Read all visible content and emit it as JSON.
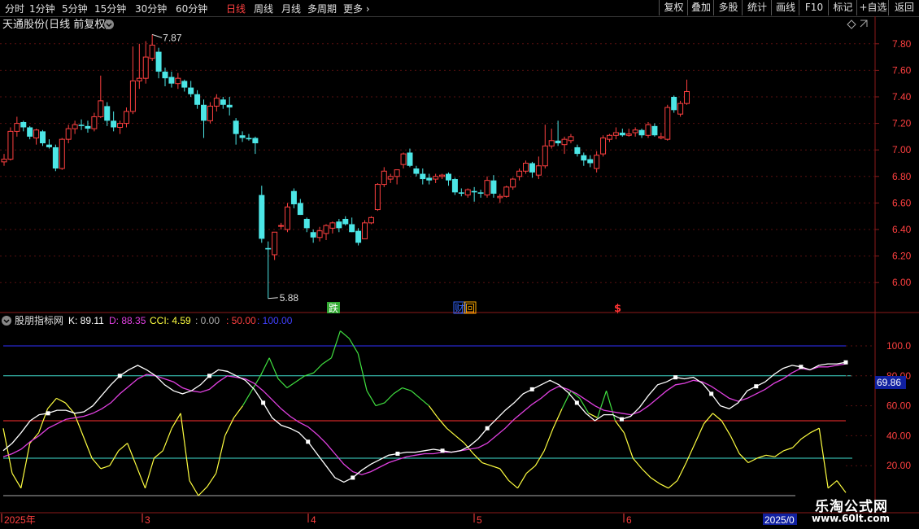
{
  "toolbar": {
    "timeframes": [
      {
        "label": "分时",
        "active": false
      },
      {
        "label": "1分钟",
        "active": false
      },
      {
        "label": "5分钟",
        "active": false
      },
      {
        "label": "15分钟",
        "active": false
      },
      {
        "label": "30分钟",
        "active": false
      },
      {
        "label": "60分钟",
        "active": false
      },
      {
        "label": "日线",
        "active": true
      },
      {
        "label": "周线",
        "active": false
      },
      {
        "label": "月线",
        "active": false
      },
      {
        "label": "多周期",
        "active": false
      },
      {
        "label": "更多",
        "active": false
      }
    ],
    "buttons": [
      "复权",
      "叠加",
      "多股",
      "统计",
      "画线",
      "F10",
      "标记",
      "+自选",
      "返回"
    ]
  },
  "stock": {
    "title": "天通股份(日线 前复权)"
  },
  "price_chart": {
    "y_ticks": [
      "7.80",
      "7.60",
      "7.40",
      "7.20",
      "7.00",
      "6.80",
      "6.60",
      "6.40",
      "6.20",
      "6.00"
    ],
    "high_label": "7.87",
    "low_label": "5.88",
    "markers": [
      {
        "text": "跌",
        "color": "#33aa33"
      },
      {
        "text": "财",
        "color": "#3366ff"
      },
      {
        "text": "回",
        "color": "#ffaa00"
      },
      {
        "text": "$",
        "color": "#ff3333"
      }
    ]
  },
  "indicator": {
    "name": "股朋指标网",
    "k_label": "K: 89.11",
    "d_label": "D: 88.35",
    "cci_label": "CCI: 4.59",
    "v0": ": 0.00",
    "v50": ": 50.00",
    "v100": ": 100.00",
    "y_ticks": [
      "100.0",
      "80.00",
      "60.00",
      "40.00",
      "20.00"
    ],
    "current": "69.86"
  },
  "date_axis": {
    "labels": [
      "2025年",
      "3",
      "4",
      "5",
      "6"
    ],
    "current": "2025/0"
  },
  "watermark": {
    "line1": "乐淘公式网",
    "line2": "www.60lt.com"
  },
  "colors": {
    "up": "#ff4040",
    "down": "#4ce6e6",
    "k": "#ffffff",
    "d": "#e040e0",
    "cci": "#ffff40",
    "cci_high": "#40e040"
  },
  "chart_data": {
    "type": "candlestick",
    "ohlc": [
      [
        6.91,
        6.97,
        6.88,
        6.93
      ],
      [
        6.93,
        7.17,
        6.92,
        7.14
      ],
      [
        7.14,
        7.25,
        7.1,
        7.2
      ],
      [
        7.21,
        7.22,
        7.14,
        7.17
      ],
      [
        7.17,
        7.18,
        7.08,
        7.1
      ],
      [
        7.09,
        7.16,
        7.04,
        7.15
      ],
      [
        7.14,
        7.15,
        7.03,
        7.05
      ],
      [
        7.04,
        7.08,
        7.01,
        7.02
      ],
      [
        7.02,
        7.04,
        6.84,
        6.86
      ],
      [
        6.86,
        7.09,
        6.85,
        7.08
      ],
      [
        7.08,
        7.19,
        7.05,
        7.16
      ],
      [
        7.16,
        7.22,
        7.12,
        7.19
      ],
      [
        7.19,
        7.23,
        7.15,
        7.18
      ],
      [
        7.18,
        7.22,
        7.13,
        7.16
      ],
      [
        7.16,
        7.28,
        7.14,
        7.25
      ],
      [
        7.25,
        7.56,
        7.24,
        7.37
      ],
      [
        7.33,
        7.36,
        7.18,
        7.22
      ],
      [
        7.22,
        7.29,
        7.14,
        7.17
      ],
      [
        7.17,
        7.22,
        7.12,
        7.2
      ],
      [
        7.2,
        7.32,
        7.17,
        7.29
      ],
      [
        7.29,
        7.78,
        7.27,
        7.52
      ],
      [
        7.52,
        7.8,
        7.46,
        7.54
      ],
      [
        7.54,
        7.82,
        7.5,
        7.7
      ],
      [
        7.69,
        7.87,
        7.67,
        7.79
      ],
      [
        7.74,
        7.77,
        7.54,
        7.59
      ],
      [
        7.59,
        7.62,
        7.48,
        7.54
      ],
      [
        7.55,
        7.59,
        7.47,
        7.5
      ],
      [
        7.5,
        7.58,
        7.46,
        7.54
      ],
      [
        7.52,
        7.53,
        7.44,
        7.47
      ],
      [
        7.47,
        7.52,
        7.4,
        7.42
      ],
      [
        7.42,
        7.45,
        7.31,
        7.34
      ],
      [
        7.34,
        7.38,
        7.09,
        7.22
      ],
      [
        7.22,
        7.36,
        7.2,
        7.33
      ],
      [
        7.33,
        7.42,
        7.29,
        7.39
      ],
      [
        7.38,
        7.4,
        7.31,
        7.34
      ],
      [
        7.34,
        7.4,
        7.26,
        7.32
      ],
      [
        7.22,
        7.24,
        7.04,
        7.12
      ],
      [
        7.11,
        7.14,
        7.06,
        7.09
      ],
      [
        7.09,
        7.12,
        7.07,
        7.08
      ],
      [
        7.09,
        7.1,
        6.97,
        7.05
      ],
      [
        6.66,
        6.73,
        6.3,
        6.33
      ],
      [
        6.26,
        6.31,
        5.88,
        6.25
      ],
      [
        6.21,
        6.38,
        6.17,
        6.38
      ],
      [
        6.43,
        6.45,
        6.4,
        6.43
      ],
      [
        6.4,
        6.6,
        6.38,
        6.57
      ],
      [
        6.69,
        6.71,
        6.56,
        6.59
      ],
      [
        6.6,
        6.63,
        6.51,
        6.51
      ],
      [
        6.48,
        6.49,
        6.38,
        6.41
      ],
      [
        6.38,
        6.4,
        6.3,
        6.34
      ],
      [
        6.34,
        6.42,
        6.31,
        6.39
      ],
      [
        6.37,
        6.44,
        6.32,
        6.43
      ],
      [
        6.41,
        6.46,
        6.37,
        6.45
      ],
      [
        6.46,
        6.48,
        6.38,
        6.41
      ],
      [
        6.48,
        6.5,
        6.43,
        6.44
      ],
      [
        6.44,
        6.49,
        6.38,
        6.38
      ],
      [
        6.39,
        6.41,
        6.28,
        6.3
      ],
      [
        6.33,
        6.47,
        6.33,
        6.45
      ],
      [
        6.45,
        6.5,
        6.44,
        6.49
      ],
      [
        6.55,
        6.75,
        6.54,
        6.74
      ],
      [
        6.74,
        6.87,
        6.72,
        6.84
      ],
      [
        6.78,
        6.82,
        6.75,
        6.8
      ],
      [
        6.8,
        6.85,
        6.74,
        6.85
      ],
      [
        6.89,
        6.98,
        6.86,
        6.97
      ],
      [
        6.98,
        7.01,
        6.87,
        6.88
      ],
      [
        6.86,
        6.88,
        6.8,
        6.82
      ],
      [
        6.82,
        6.86,
        6.74,
        6.78
      ],
      [
        6.79,
        6.82,
        6.74,
        6.77
      ],
      [
        6.78,
        6.82,
        6.75,
        6.8
      ],
      [
        6.8,
        6.82,
        6.78,
        6.81
      ],
      [
        6.82,
        6.83,
        6.73,
        6.77
      ],
      [
        6.78,
        6.79,
        6.66,
        6.68
      ],
      [
        6.68,
        6.71,
        6.65,
        6.67
      ],
      [
        6.66,
        6.71,
        6.64,
        6.7
      ],
      [
        6.69,
        6.72,
        6.61,
        6.68
      ],
      [
        6.68,
        6.7,
        6.64,
        6.67
      ],
      [
        6.66,
        6.8,
        6.64,
        6.77
      ],
      [
        6.77,
        6.81,
        6.64,
        6.67
      ],
      [
        6.64,
        6.67,
        6.6,
        6.65
      ],
      [
        6.65,
        6.73,
        6.64,
        6.72
      ],
      [
        6.72,
        6.79,
        6.7,
        6.78
      ],
      [
        6.8,
        6.86,
        6.77,
        6.84
      ],
      [
        6.84,
        6.92,
        6.82,
        6.9
      ],
      [
        6.9,
        6.91,
        6.79,
        6.83
      ],
      [
        6.81,
        6.95,
        6.78,
        6.88
      ],
      [
        6.88,
        7.19,
        6.86,
        7.03
      ],
      [
        7.03,
        7.16,
        7.01,
        7.07
      ],
      [
        7.07,
        7.22,
        7.03,
        7.05
      ],
      [
        7.04,
        7.1,
        6.97,
        7.08
      ],
      [
        7.07,
        7.12,
        7.05,
        7.1
      ],
      [
        7.02,
        7.04,
        6.95,
        6.97
      ],
      [
        6.96,
        6.98,
        6.88,
        6.92
      ],
      [
        6.93,
        6.96,
        6.87,
        6.9
      ],
      [
        6.86,
        6.99,
        6.83,
        6.96
      ],
      [
        6.97,
        7.11,
        6.95,
        7.09
      ],
      [
        7.08,
        7.12,
        7.06,
        7.11
      ],
      [
        7.11,
        7.17,
        7.08,
        7.13
      ],
      [
        7.13,
        7.16,
        7.1,
        7.11
      ],
      [
        7.11,
        7.16,
        7.1,
        7.12
      ],
      [
        7.13,
        7.17,
        7.1,
        7.15
      ],
      [
        7.15,
        7.16,
        7.09,
        7.11
      ],
      [
        7.11,
        7.21,
        7.09,
        7.19
      ],
      [
        7.18,
        7.2,
        7.1,
        7.11
      ],
      [
        7.09,
        7.13,
        7.08,
        7.1
      ],
      [
        7.08,
        7.34,
        7.07,
        7.32
      ],
      [
        7.4,
        7.41,
        7.28,
        7.3
      ],
      [
        7.27,
        7.37,
        7.25,
        7.35
      ],
      [
        7.35,
        7.53,
        7.34,
        7.44
      ]
    ],
    "k": [
      30,
      35,
      42,
      50,
      54,
      55,
      57,
      57,
      55,
      56,
      60,
      67,
      74,
      80,
      84,
      87,
      84,
      80,
      74,
      70,
      68,
      70,
      74,
      80,
      84,
      83,
      80,
      77,
      71,
      62,
      52,
      47,
      45,
      42,
      36,
      28,
      20,
      12,
      9,
      12,
      17,
      21,
      24,
      27,
      28,
      29,
      29,
      30,
      31,
      30,
      29,
      30,
      33,
      38,
      45,
      51,
      57,
      62,
      68,
      71,
      74,
      77,
      74,
      69,
      62,
      55,
      50,
      54,
      54,
      51,
      53,
      59,
      67,
      74,
      76,
      79,
      78,
      79,
      75,
      68,
      60,
      58,
      62,
      70,
      73,
      76,
      81,
      85,
      87,
      86,
      84,
      87,
      88,
      88,
      89
    ],
    "d": [
      26,
      28,
      31,
      36,
      40,
      45,
      48,
      51,
      52,
      53,
      55,
      58,
      62,
      68,
      73,
      78,
      81,
      80,
      78,
      76,
      72,
      70,
      69,
      71,
      76,
      80,
      79,
      78,
      75,
      70,
      64,
      58,
      53,
      49,
      46,
      41,
      35,
      28,
      21,
      16,
      14,
      16,
      19,
      22,
      24,
      26,
      27,
      28,
      28,
      29,
      29,
      30,
      31,
      32,
      35,
      40,
      45,
      51,
      56,
      61,
      65,
      70,
      73,
      71,
      68,
      64,
      60,
      57,
      56,
      55,
      54,
      56,
      60,
      65,
      70,
      74,
      75,
      77,
      76,
      73,
      69,
      65,
      63,
      65,
      68,
      71,
      75,
      78,
      82,
      85,
      84,
      86,
      86,
      87,
      88
    ],
    "cci": [
      45,
      15,
      5,
      35,
      42,
      58,
      65,
      62,
      55,
      40,
      25,
      18,
      20,
      30,
      35,
      20,
      5,
      25,
      30,
      45,
      55,
      10,
      0,
      6,
      15,
      40,
      52,
      60,
      70,
      80,
      92,
      78,
      72,
      76,
      80,
      82,
      88,
      92,
      110,
      105,
      95,
      70,
      60,
      62,
      68,
      72,
      70,
      65,
      60,
      52,
      45,
      40,
      35,
      28,
      22,
      20,
      18,
      10,
      5,
      15,
      20,
      30,
      45,
      58,
      70,
      65,
      55,
      52,
      70,
      50,
      42,
      25,
      18,
      12,
      8,
      5,
      10,
      22,
      35,
      48,
      55,
      50,
      40,
      28,
      22,
      25,
      27,
      26,
      30,
      32,
      38,
      42,
      45,
      5,
      10,
      2
    ],
    "y_ticks": [
      "7.80",
      "7.60",
      "7.40",
      "7.20",
      "7.00",
      "6.80",
      "6.60",
      "6.40",
      "6.20",
      "6.00"
    ]
  }
}
